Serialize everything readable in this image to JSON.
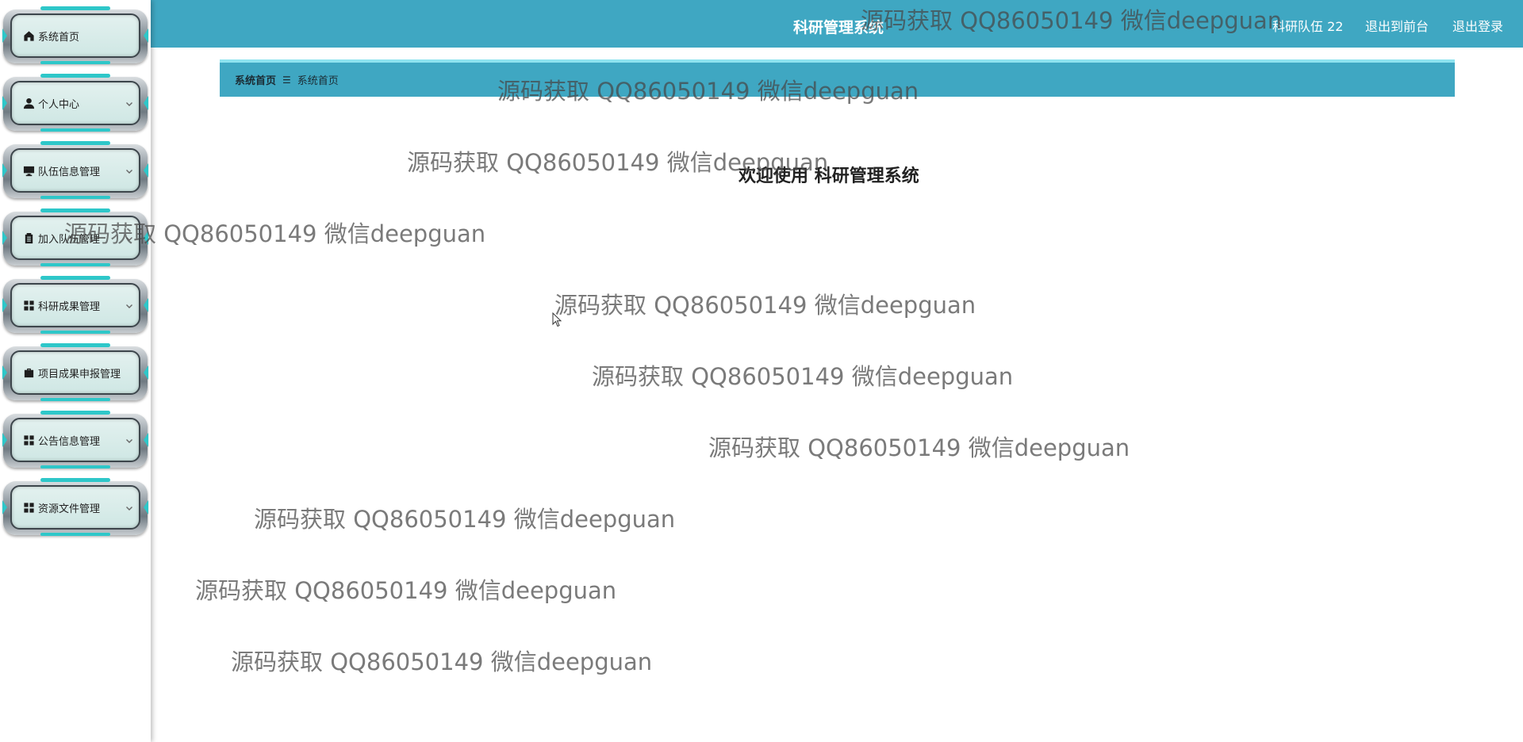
{
  "header": {
    "title": "科研管理系统",
    "user": "科研队伍 22",
    "front_link": "退出到前台",
    "logout_link": "退出登录"
  },
  "sidebar": {
    "items": [
      {
        "label": "系统首页",
        "icon": "home-icon",
        "has_submenu": false
      },
      {
        "label": "个人中心",
        "icon": "user-icon",
        "has_submenu": true
      },
      {
        "label": "队伍信息管理",
        "icon": "monitor-icon",
        "has_submenu": true
      },
      {
        "label": "加入队伍管理",
        "icon": "clipboard-icon",
        "has_submenu": true
      },
      {
        "label": "科研成果管理",
        "icon": "grid-icon",
        "has_submenu": true
      },
      {
        "label": "项目成果申报管理",
        "icon": "briefcase-icon",
        "has_submenu": false
      },
      {
        "label": "公告信息管理",
        "icon": "grid-icon",
        "has_submenu": true
      },
      {
        "label": "资源文件管理",
        "icon": "grid-icon",
        "has_submenu": true
      }
    ]
  },
  "breadcrumb": {
    "home": "系统首页",
    "current": "系统首页"
  },
  "welcome": {
    "prefix": "欢迎使用",
    "name": "科研管理系统"
  },
  "watermark": "源码获取 QQ86050149 微信deepguan",
  "colors": {
    "primary": "#3fa7c2",
    "accent": "#2ec7c9",
    "menu_bg": "#d4ebe8"
  }
}
